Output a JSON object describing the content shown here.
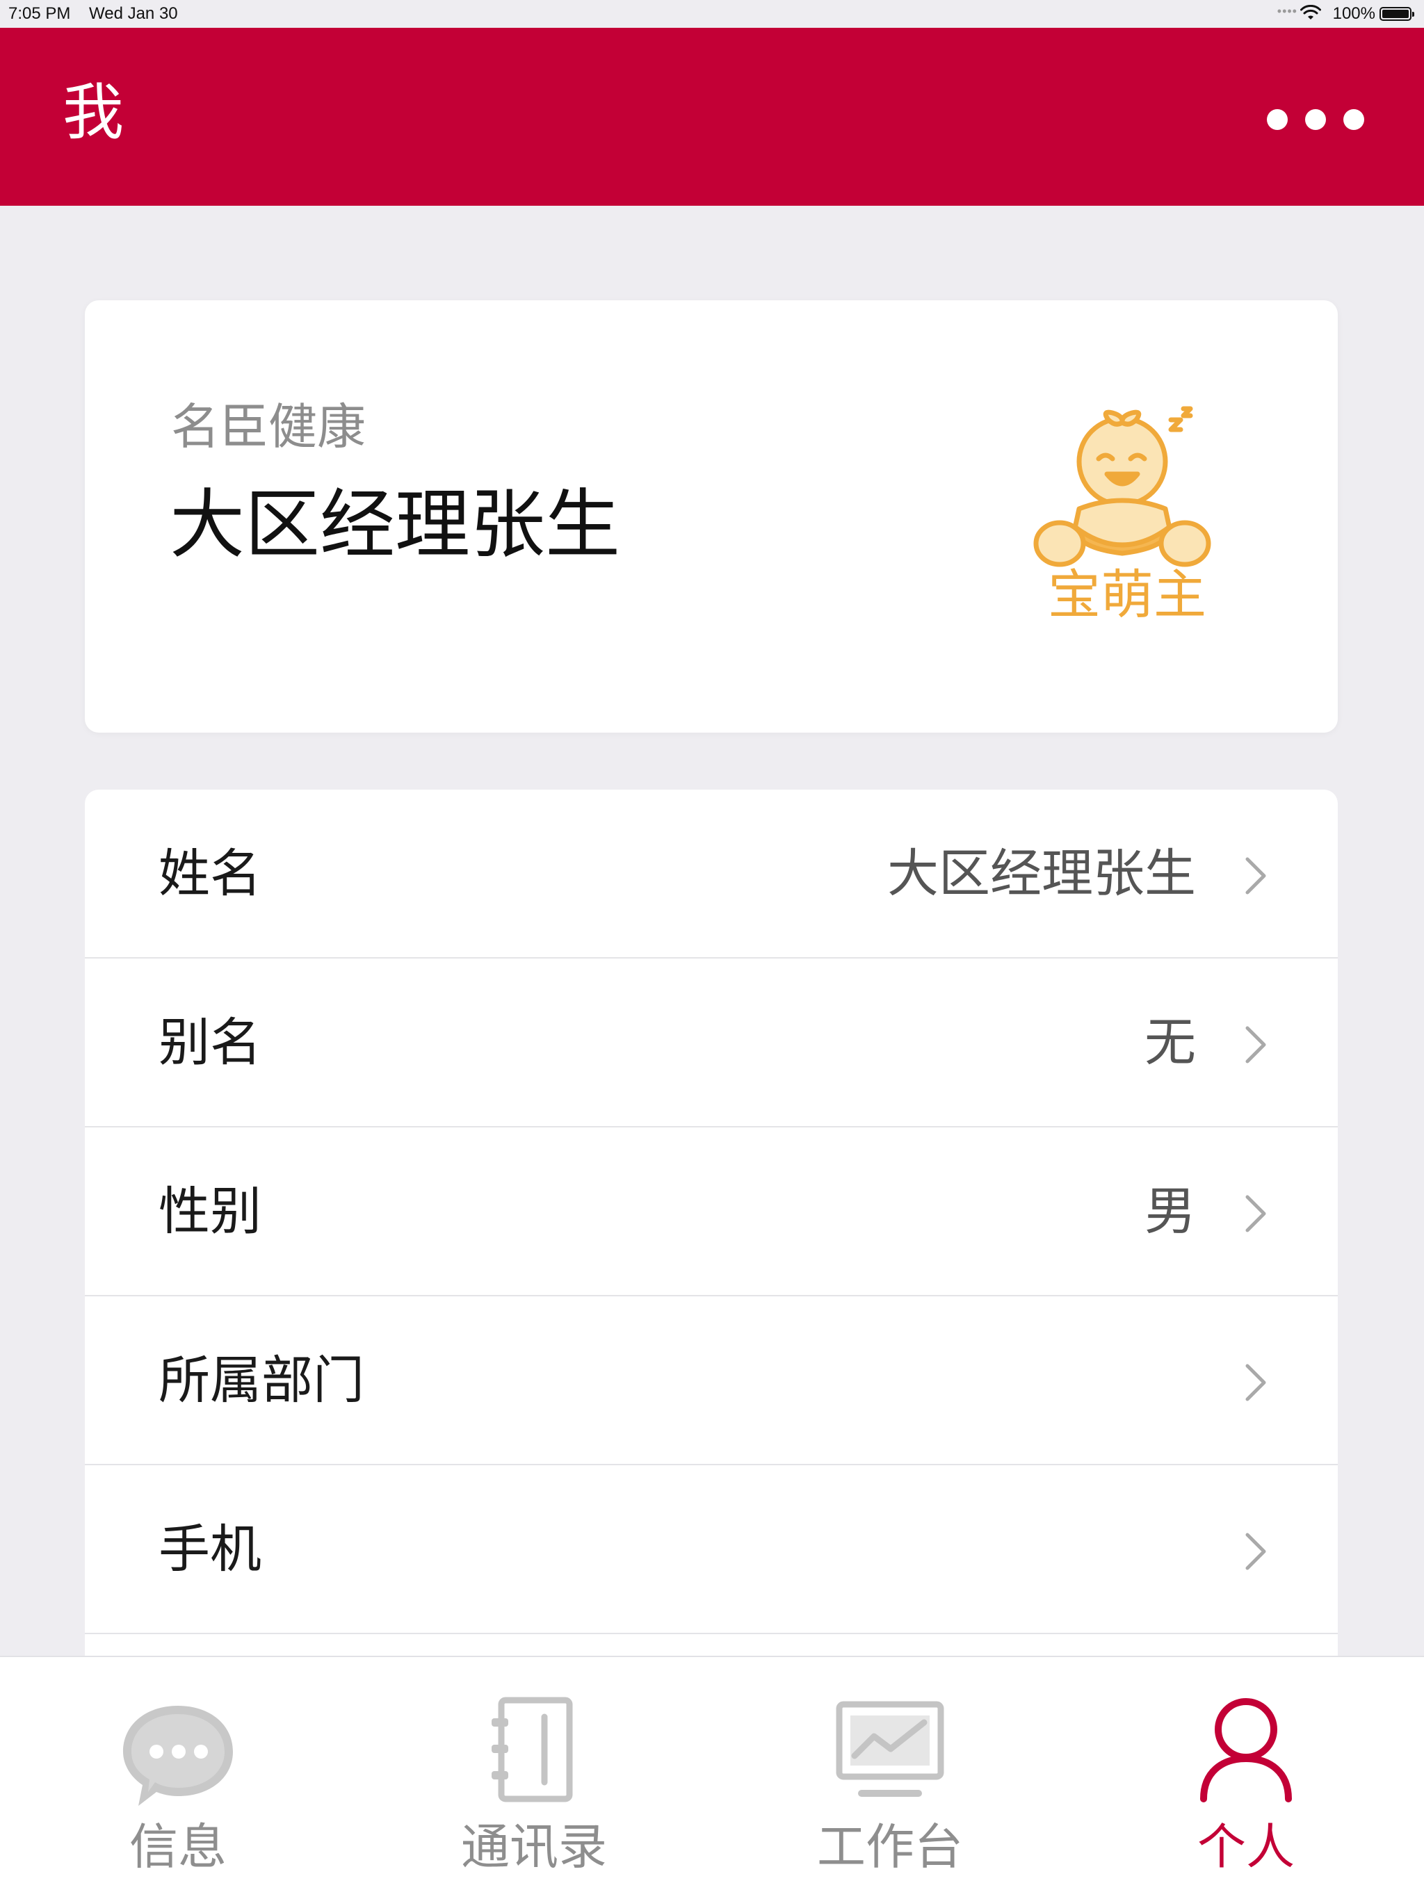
{
  "status_bar": {
    "time": "7:05 PM",
    "date": "Wed Jan 30",
    "battery": "100%"
  },
  "header": {
    "title": "我",
    "more_icon": "more-dots-icon",
    "background_color": "#c30036"
  },
  "profile": {
    "company": "名臣健康",
    "name": "大区经理张生",
    "logo_text": "宝萌主",
    "logo_color": "#f0a93a"
  },
  "info_rows": [
    {
      "label": "姓名",
      "value": "大区经理张生"
    },
    {
      "label": "别名",
      "value": "无"
    },
    {
      "label": "性别",
      "value": "男"
    },
    {
      "label": "所属部门",
      "value": ""
    },
    {
      "label": "手机",
      "value": ""
    }
  ],
  "tabs": [
    {
      "label": "信息",
      "icon": "chat-bubble-icon",
      "active": false
    },
    {
      "label": "通讯录",
      "icon": "contacts-book-icon",
      "active": false
    },
    {
      "label": "工作台",
      "icon": "monitor-chart-icon",
      "active": false
    },
    {
      "label": "个人",
      "icon": "person-icon",
      "active": true
    }
  ],
  "colors": {
    "accent": "#c30036",
    "inactive_tab": "#8e8e8e",
    "background": "#eeedf1"
  }
}
